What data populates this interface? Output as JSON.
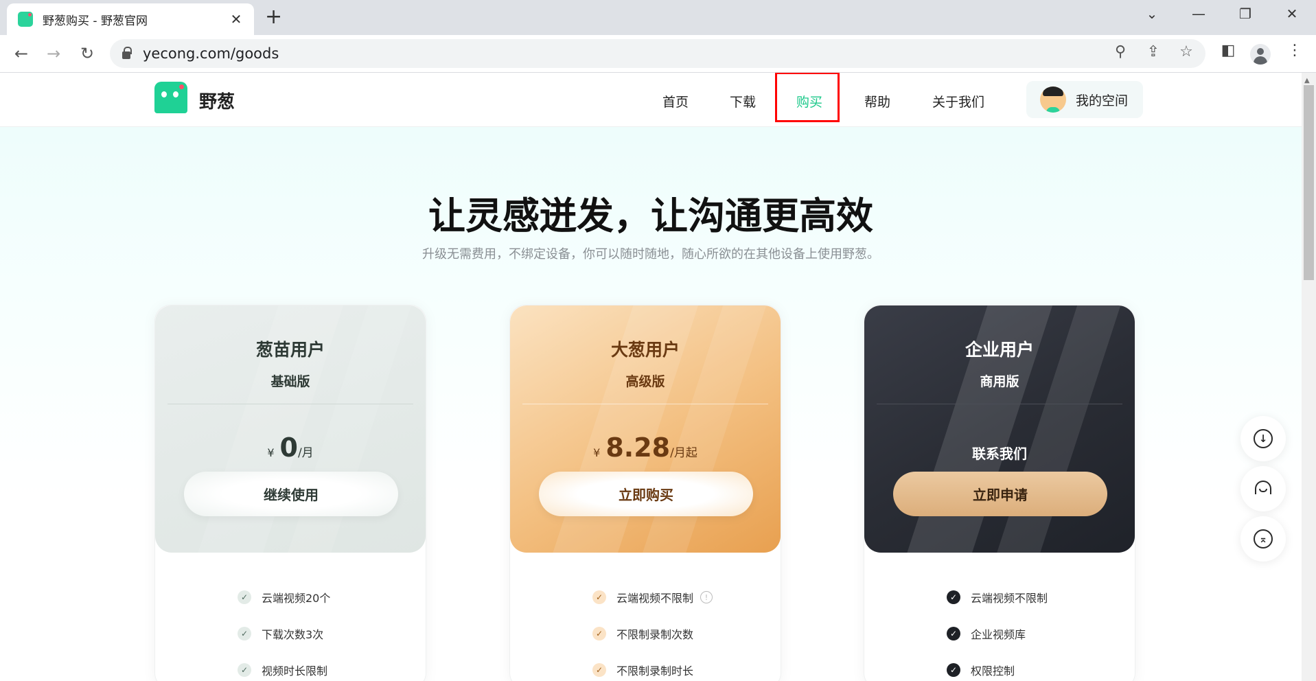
{
  "browser": {
    "tab_title": "野葱购买 - 野葱官网",
    "tab_close": "✕",
    "new_tab": "+",
    "url": "yecong.com/goods",
    "win_chevron": "⌄",
    "win_minimize": "—",
    "win_restore": "❐",
    "win_close": "✕",
    "back": "←",
    "forward": "→",
    "reload": "↻",
    "zoom": "⚲",
    "share": "⇪",
    "star": "☆",
    "sidepanel": "◧",
    "menu": "⋮"
  },
  "header": {
    "logo_text": "野葱",
    "nav": [
      "首页",
      "下载",
      "购买",
      "帮助",
      "关于我们"
    ],
    "active_nav": "购买",
    "space_label": "我的空间"
  },
  "hero": {
    "title": "让灵感迸发，让沟通更高效",
    "subtitle": "升级无需费用，不绑定设备，你可以随时随地，随心所欲的在其他设备上使用野葱。"
  },
  "plans": [
    {
      "name": "葱苗用户",
      "tier": "基础版",
      "currency": "¥",
      "amount": "0",
      "unit": "/月",
      "cta": "继续使用",
      "features": [
        "云端视频20个",
        "下载次数3次",
        "视频时长限制"
      ]
    },
    {
      "name": "大葱用户",
      "tier": "高级版",
      "currency": "¥",
      "amount": "8.28",
      "unit": "/月起",
      "cta": "立即购买",
      "features": [
        "云端视频不限制",
        "不限制录制次数",
        "不限制录制时长"
      ]
    },
    {
      "name": "企业用户",
      "tier": "商用版",
      "contact": "联系我们",
      "cta": "立即申请",
      "features": [
        "云端视频不限制",
        "企业视频库",
        "权限控制"
      ]
    }
  ],
  "icons": {
    "check": "✓",
    "info": "!",
    "download": "↓",
    "top": "⌅"
  },
  "colors": {
    "accent": "#1cc88a",
    "highlight_box": "#ff0000",
    "pro_gold": "#e8a050",
    "enterprise_dark": "#2a2d35"
  }
}
